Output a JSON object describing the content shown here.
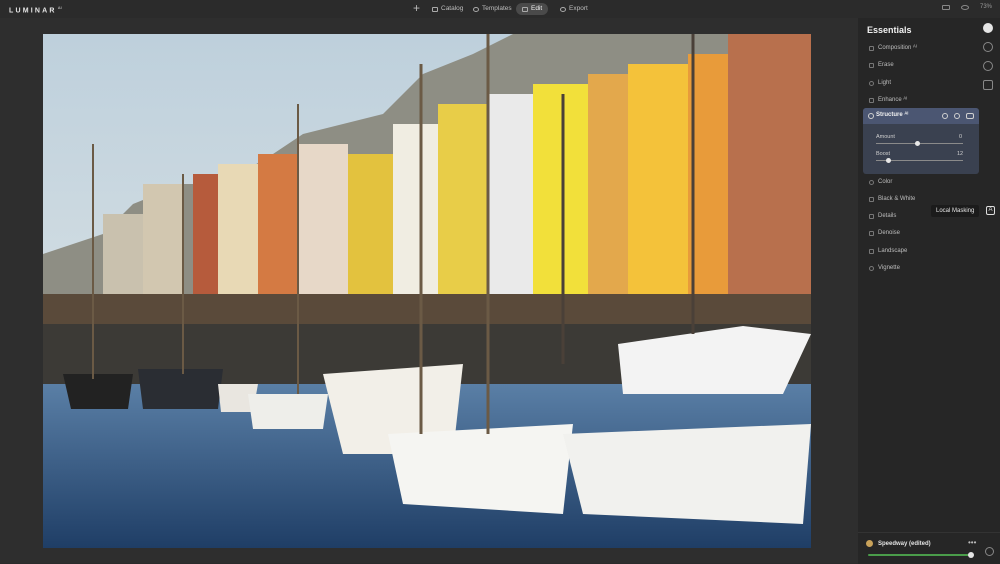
{
  "app": {
    "logo": "LUMINAR",
    "logo_sup": "AI"
  },
  "topbar": {
    "add_label": "+",
    "tabs": [
      {
        "label": "Catalog",
        "icon": "catalog-icon"
      },
      {
        "label": "Templates",
        "icon": "templates-icon"
      },
      {
        "label": "Edit",
        "icon": "edit-icon"
      },
      {
        "label": "Export",
        "icon": "export-icon"
      }
    ],
    "active_tab": "Edit",
    "zoom": "73%"
  },
  "panel": {
    "title": "Essentials",
    "tools": [
      {
        "label": "Composition ᴬᴵ"
      },
      {
        "label": "Erase"
      },
      {
        "label": "Light"
      },
      {
        "label": "Enhance ᴬᴵ"
      },
      {
        "label": "Color"
      },
      {
        "label": "Black & White"
      },
      {
        "label": "Details"
      },
      {
        "label": "Denoise"
      },
      {
        "label": "Landscape"
      },
      {
        "label": "Vignette"
      }
    ],
    "structure": {
      "title": "Structure ᴬᴵ",
      "sliders": [
        {
          "label": "Amount",
          "value": "0",
          "fraction": 0.5
        },
        {
          "label": "Boost",
          "value": "12",
          "fraction": 0.12
        }
      ]
    },
    "tooltip": "Local Masking"
  },
  "preset": {
    "name": "Speedway (edited)",
    "more": "•••",
    "amount_fraction": 1.0
  },
  "colors": {
    "accent": "#4b5672",
    "slider_green": "#4a9c4a",
    "panel_bg": "#262626"
  }
}
